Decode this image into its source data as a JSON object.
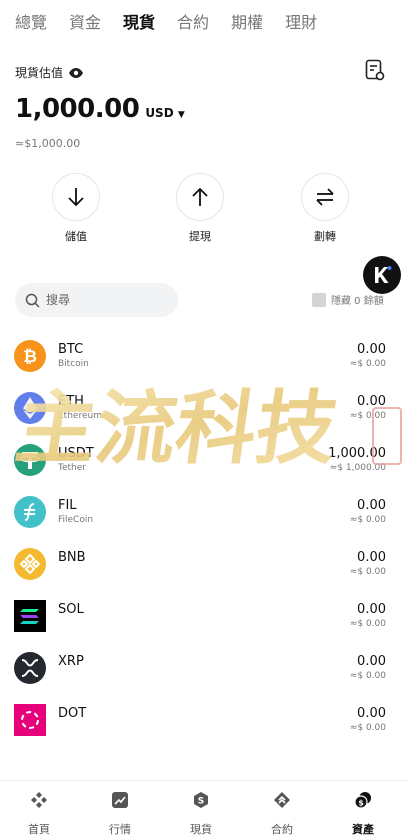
{
  "tabs": [
    {
      "label": "總覽",
      "active": false
    },
    {
      "label": "資金",
      "active": false
    },
    {
      "label": "現貨",
      "active": true
    },
    {
      "label": "合約",
      "active": false
    },
    {
      "label": "期權",
      "active": false
    },
    {
      "label": "理財",
      "active": false
    }
  ],
  "estimate": {
    "label": "現貨估值",
    "value": "1,000.00",
    "currency": "USD",
    "approx": "≈$1,000.00"
  },
  "actions": [
    {
      "label": "儲值",
      "icon": "arrow-down-icon"
    },
    {
      "label": "提現",
      "icon": "arrow-up-icon"
    },
    {
      "label": "劃轉",
      "icon": "transfer-icon"
    }
  ],
  "search": {
    "placeholder": "搜尋"
  },
  "hide_zero": {
    "label": "隱藏 0 餘額",
    "checked": false
  },
  "assets": [
    {
      "symbol": "BTC",
      "name": "Bitcoin",
      "amount": "0.00",
      "fiat": "≈$ 0.00",
      "color": "#F7931A"
    },
    {
      "symbol": "ETH",
      "name": "Ethereum",
      "amount": "0.00",
      "fiat": "≈$ 0.00",
      "color": "#627EEA"
    },
    {
      "symbol": "USDT",
      "name": "Tether",
      "amount": "1,000.00",
      "fiat": "≈$ 1,000.00",
      "color": "#26A17B"
    },
    {
      "symbol": "FIL",
      "name": "FileCoin",
      "amount": "0.00",
      "fiat": "≈$ 0.00",
      "color": "#42C1CA"
    },
    {
      "symbol": "BNB",
      "name": "",
      "amount": "0.00",
      "fiat": "≈$ 0.00",
      "color": "#F3BA2F"
    },
    {
      "symbol": "SOL",
      "name": "",
      "amount": "0.00",
      "fiat": "≈$ 0.00",
      "color": "#000000"
    },
    {
      "symbol": "XRP",
      "name": "",
      "amount": "0.00",
      "fiat": "≈$ 0.00",
      "color": "#23292F"
    },
    {
      "symbol": "DOT",
      "name": "",
      "amount": "0.00",
      "fiat": "≈$ 0.00",
      "color": "#E6007A"
    }
  ],
  "watermark": {
    "text": "主流科技"
  },
  "nav": [
    {
      "label": "首頁",
      "icon": "home-icon",
      "active": false
    },
    {
      "label": "行情",
      "icon": "market-icon",
      "active": false
    },
    {
      "label": "現貨",
      "icon": "spot-icon",
      "active": false
    },
    {
      "label": "合約",
      "icon": "contract-icon",
      "active": false
    },
    {
      "label": "資產",
      "icon": "assets-icon",
      "active": true
    }
  ]
}
